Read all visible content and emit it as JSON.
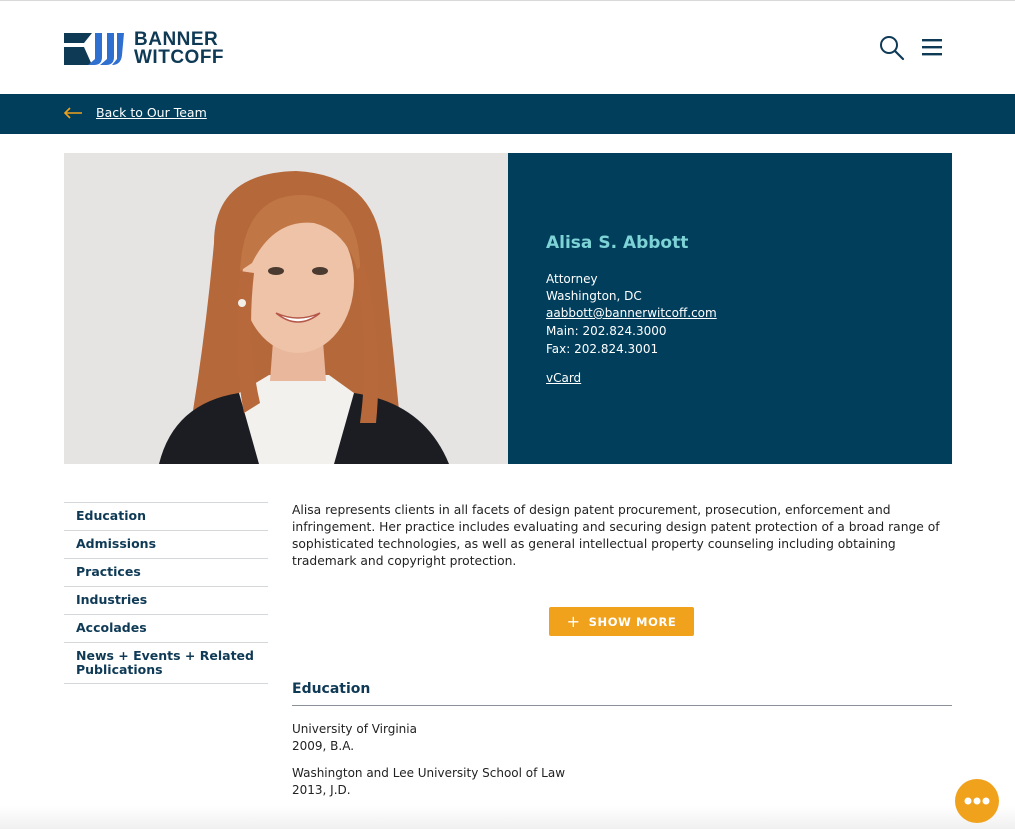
{
  "brand": {
    "line1": "BANNER",
    "line2": "WITCOFF",
    "color": "#0f3a56",
    "accent": "#2f6fd0"
  },
  "header": {
    "search_icon": "search-icon",
    "menu_icon": "hamburger-menu-icon"
  },
  "backbar": {
    "label": "Back to Our Team",
    "icon": "arrow-left-icon"
  },
  "profile": {
    "name": "Alisa S. Abbott",
    "title": "Attorney",
    "location": "Washington, DC",
    "email": "aabbott@bannerwitcoff.com",
    "main_phone": "Main: 202.824.3000",
    "fax": "Fax: 202.824.3001",
    "vcard_label": "vCard"
  },
  "sidenav": {
    "items": [
      {
        "label": "Education"
      },
      {
        "label": "Admissions"
      },
      {
        "label": "Practices"
      },
      {
        "label": "Industries"
      },
      {
        "label": "Accolades"
      },
      {
        "label": "News + Events + Related Publications"
      }
    ]
  },
  "bio": {
    "text": "Alisa represents clients in all facets of design patent procurement, prosecution, enforcement and infringement. Her practice includes evaluating and securing design patent protection of a broad range of sophisticated technologies, as well as general intellectual property counseling including obtaining trademark and copyright protection.",
    "show_more_label": "SHOW MORE"
  },
  "education": {
    "heading": "Education",
    "entries": [
      {
        "school": "University of Virginia",
        "degree": "2009, B.A."
      },
      {
        "school": "Washington and Lee University School of Law",
        "degree": "2013, J.D."
      }
    ]
  },
  "colors": {
    "navy": "#003e5c",
    "teal_name": "#7ed3d6",
    "orange": "#f0a21c"
  }
}
